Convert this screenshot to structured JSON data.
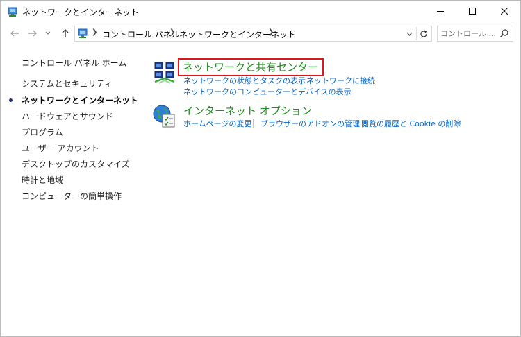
{
  "window": {
    "title": "ネットワークとインターネット"
  },
  "caption_buttons": {
    "minimize": "minimize",
    "maximize": "maximize",
    "close": "close"
  },
  "address_bar": {
    "breadcrumbs": [
      "コントロール パネル",
      "ネットワークとインターネット"
    ]
  },
  "search": {
    "placeholder": "コントロール ..."
  },
  "left_nav": {
    "home": "コントロール パネル ホーム",
    "items": [
      "システムとセキュリティ",
      "ネットワークとインターネット",
      "ハードウェアとサウンド",
      "プログラム",
      "ユーザー アカウント",
      "デスクトップのカスタマイズ",
      "時計と地域",
      "コンピューターの簡単操作"
    ],
    "current_index": 1
  },
  "categories": [
    {
      "title": "ネットワークと共有センター",
      "icon": "network-sharing-center-icon",
      "links": [
        "ネットワークの状態とタスクの表示",
        "ネットワークに接続",
        "ネットワークのコンピューターとデバイスの表示"
      ]
    },
    {
      "title": "インターネット オプション",
      "icon": "internet-options-icon",
      "links": [
        "ホームページの変更",
        "ブラウザーのアドオンの管理",
        "閲覧の履歴と Cookie の削除"
      ]
    }
  ],
  "colors": {
    "link": "#0066cc",
    "category_title": "#1e8c1e",
    "highlight_box": "#e0141e",
    "current_bullet": "#1e3287"
  }
}
